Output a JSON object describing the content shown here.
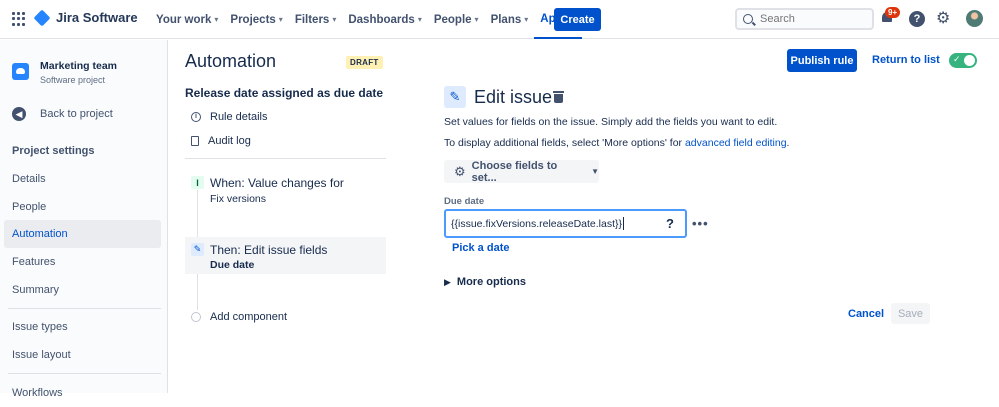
{
  "topnav": {
    "app_name": "Jira Software",
    "menu": [
      {
        "label": "Your work"
      },
      {
        "label": "Projects"
      },
      {
        "label": "Filters"
      },
      {
        "label": "Dashboards"
      },
      {
        "label": "People"
      },
      {
        "label": "Plans"
      },
      {
        "label": "Apps"
      }
    ],
    "active_menu": "Apps",
    "create_label": "Create",
    "search_placeholder": "Search",
    "notification_count": "9+",
    "help_symbol": "?"
  },
  "sidebar": {
    "project_name": "Marketing team",
    "project_type": "Software project",
    "back_label": "Back to project",
    "section_heading": "Project settings",
    "items": [
      {
        "label": "Details"
      },
      {
        "label": "People"
      },
      {
        "label": "Automation"
      },
      {
        "label": "Features"
      },
      {
        "label": "Summary"
      },
      {
        "label": "Issue types"
      },
      {
        "label": "Issue layout"
      },
      {
        "label": "Workflows"
      }
    ],
    "active_item": "Automation"
  },
  "automation": {
    "title": "Automation",
    "status_badge": "DRAFT",
    "rule_name": "Release date assigned as due date",
    "rule_details": "Rule details",
    "audit_log": "Audit log",
    "steps": [
      {
        "title": "When: Value changes for",
        "subtitle": "Fix versions"
      },
      {
        "title": "Then: Edit issue fields",
        "subtitle": "Due date"
      }
    ],
    "add_component": "Add component"
  },
  "header_actions": {
    "publish_label": "Publish rule",
    "return_label": "Return to list",
    "enabled": true
  },
  "edit_panel": {
    "title": "Edit issue",
    "description": "Set values for fields on the issue. Simply add the fields you want to edit.",
    "additional_prefix": "To display additional fields, select 'More options' for ",
    "additional_link": "advanced field editing",
    "additional_suffix": ".",
    "choose_fields_label": "Choose fields to set...",
    "due_date_label": "Due date",
    "due_date_value": "{{issue.fixVersions.releaseDate.last}}",
    "pick_date_label": "Pick a date",
    "more_options_label": "More options",
    "cancel_label": "Cancel",
    "save_label": "Save"
  },
  "colors": {
    "brand": "#0052cc",
    "toggle_on": "#36b37e",
    "draft_bg": "#fff0b3",
    "badge": "#de350b"
  }
}
